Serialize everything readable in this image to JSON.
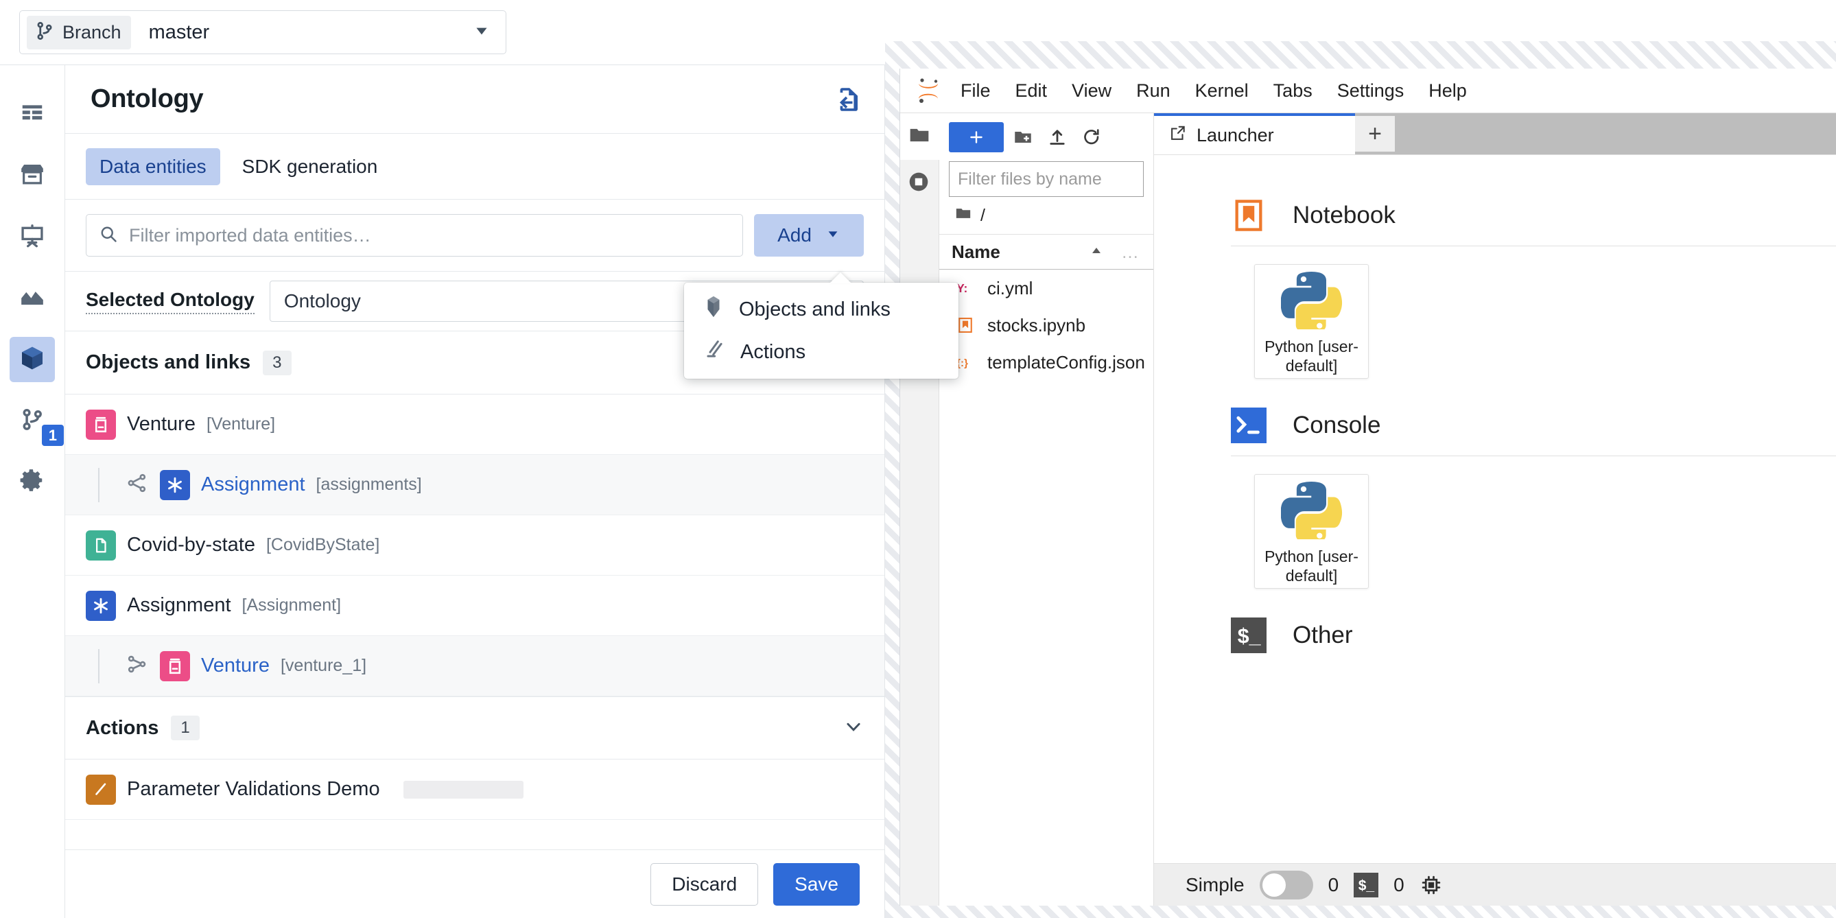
{
  "branch": {
    "chip_label": "Branch",
    "value": "master",
    "icon": "git-branch-icon",
    "caret": "chevron-down-icon"
  },
  "rail": {
    "items": [
      {
        "name": "table-icon",
        "label": "Table"
      },
      {
        "name": "archive-icon",
        "label": "Archive"
      },
      {
        "name": "presentation-icon",
        "label": "Presentation"
      },
      {
        "name": "area-chart-icon",
        "label": "Area chart"
      },
      {
        "name": "cube-icon",
        "label": "Ontology",
        "active": true
      },
      {
        "name": "git-branch-icon",
        "label": "Branches",
        "badge": "1"
      },
      {
        "name": "gear-icon",
        "label": "Settings"
      }
    ]
  },
  "ontology": {
    "title": "Ontology",
    "export_icon": "document-export-icon",
    "tabs": [
      {
        "label": "Data entities",
        "active": true
      },
      {
        "label": "SDK generation",
        "active": false
      }
    ],
    "filter": {
      "placeholder": "Filter imported data entities…",
      "value": "",
      "icon": "search-icon"
    },
    "add_button": {
      "label": "Add",
      "caret": "chevron-down-icon"
    },
    "selected_ontology": {
      "label": "Selected Ontology",
      "value": "Ontology"
    },
    "sections": [
      {
        "title": "Objects and links",
        "count": "3"
      },
      {
        "title": "Actions",
        "count": "1",
        "chevron": "chevron-down-icon"
      }
    ],
    "entities": [
      {
        "name": "Venture",
        "api": "[Venture]",
        "icon": "venture-icon",
        "child": false
      },
      {
        "name": "Assignment",
        "api": "[assignments]",
        "icon": "assignment-icon",
        "child": true,
        "link_icon": "link-graph-icon"
      },
      {
        "name": "Covid-by-state",
        "api": "[CovidByState]",
        "icon": "document-icon",
        "child": false
      },
      {
        "name": "Assignment",
        "api": "[Assignment]",
        "icon": "assignment-icon",
        "child": false
      },
      {
        "name": "Venture",
        "api": "[venture_1]",
        "icon": "venture-icon",
        "child": true,
        "link_icon": "link-cut-icon"
      }
    ],
    "actions": [
      {
        "name": "Parameter Validations Demo",
        "icon": "edit-pencil-icon",
        "redacted": true
      }
    ],
    "footer": {
      "discard_label": "Discard",
      "save_label": "Save"
    }
  },
  "add_menu": {
    "items": [
      {
        "label": "Objects and links",
        "icon": "cube-3d-icon"
      },
      {
        "label": "Actions",
        "icon": "action-slash-icon"
      }
    ]
  },
  "jupyter": {
    "logo": "jupyter-logo-icon",
    "menus": [
      "File",
      "Edit",
      "View",
      "Run",
      "Kernel",
      "Tabs",
      "Settings",
      "Help"
    ],
    "rail": [
      {
        "name": "folder-icon",
        "label": "File Browser",
        "active": true
      },
      {
        "name": "running-stop-icon",
        "label": "Running Terminals and Kernels",
        "active": false
      }
    ],
    "file_browser": {
      "new_launcher_label": "+",
      "toolbar_icons": [
        "new-folder-icon",
        "upload-icon",
        "refresh-icon"
      ],
      "filter": {
        "placeholder": "Filter files by name",
        "value": "",
        "icon": "search-icon"
      },
      "breadcrumb": {
        "icon": "folder-icon",
        "path": "/"
      },
      "column_header": {
        "name": "Name",
        "sort": "sort-asc-icon",
        "more": "…"
      },
      "files": [
        {
          "name": "ci.yml",
          "icon": "yaml-icon"
        },
        {
          "name": "stocks.ipynb",
          "icon": "notebook-icon"
        },
        {
          "name": "templateConfig.json",
          "icon": "json-icon"
        }
      ]
    },
    "tabs": [
      {
        "label": "Launcher",
        "icon": "launcher-icon",
        "active": true
      }
    ],
    "add_tab_label": "+",
    "launcher": {
      "sections": [
        {
          "title": "Notebook",
          "icon": "notebook-icon",
          "cards": [
            {
              "label": "Python [user-default]",
              "icon": "python-icon"
            }
          ]
        },
        {
          "title": "Console",
          "icon": "console-icon",
          "cards": [
            {
              "label": "Python [user-default]",
              "icon": "python-icon"
            }
          ]
        },
        {
          "title": "Other",
          "icon": "terminal-icon",
          "cards": []
        }
      ]
    },
    "status_bar": {
      "simple_label": "Simple",
      "simple_on": false,
      "kernel_count": "0",
      "terminal_icon": "terminal-icon",
      "terminal_count": "0",
      "cpu_icon": "cpu-chip-icon"
    }
  },
  "colors": {
    "accent_blue": "#2f6bd8",
    "light_blue": "#bdcef0",
    "venture_pink": "#ec4d87",
    "assignment_blue": "#2f5fc9",
    "covid_green": "#3fb295",
    "action_orange": "#c87820",
    "jupyter_orange": "#f37726"
  }
}
